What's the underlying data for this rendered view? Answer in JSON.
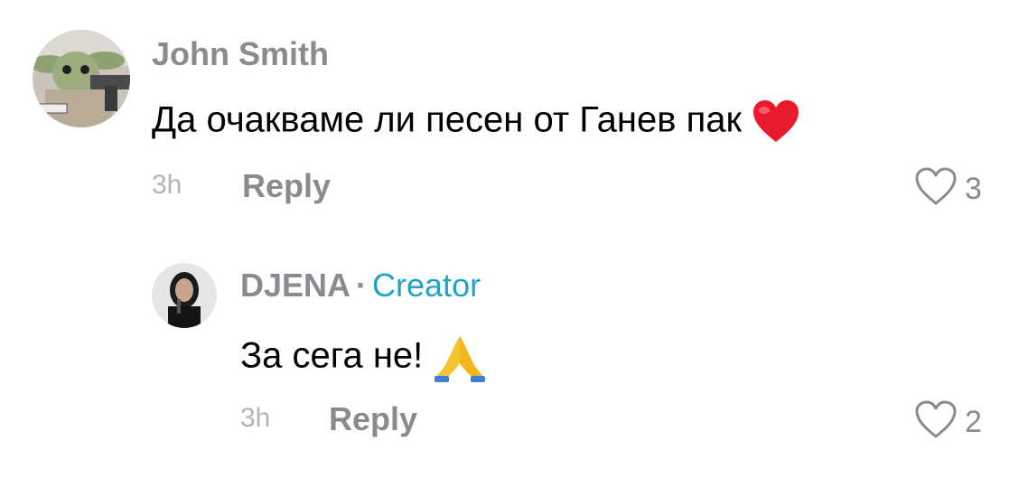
{
  "comments": [
    {
      "username": "John Smith",
      "text": "Да очакваме ли песен от Ганев пак",
      "emoji": "heart",
      "time": "3h",
      "reply_label": "Reply",
      "likes": "3"
    }
  ],
  "reply": {
    "username": "DJENA",
    "separator": "·",
    "badge": "Creator",
    "text": "За сега не!",
    "emoji": "folded-hands",
    "time": "3h",
    "reply_label": "Reply",
    "likes": "2"
  },
  "colors": {
    "creator_badge": "#23a3c4",
    "muted_text": "#8a8a8f",
    "heart_emoji": "#e8192c"
  }
}
